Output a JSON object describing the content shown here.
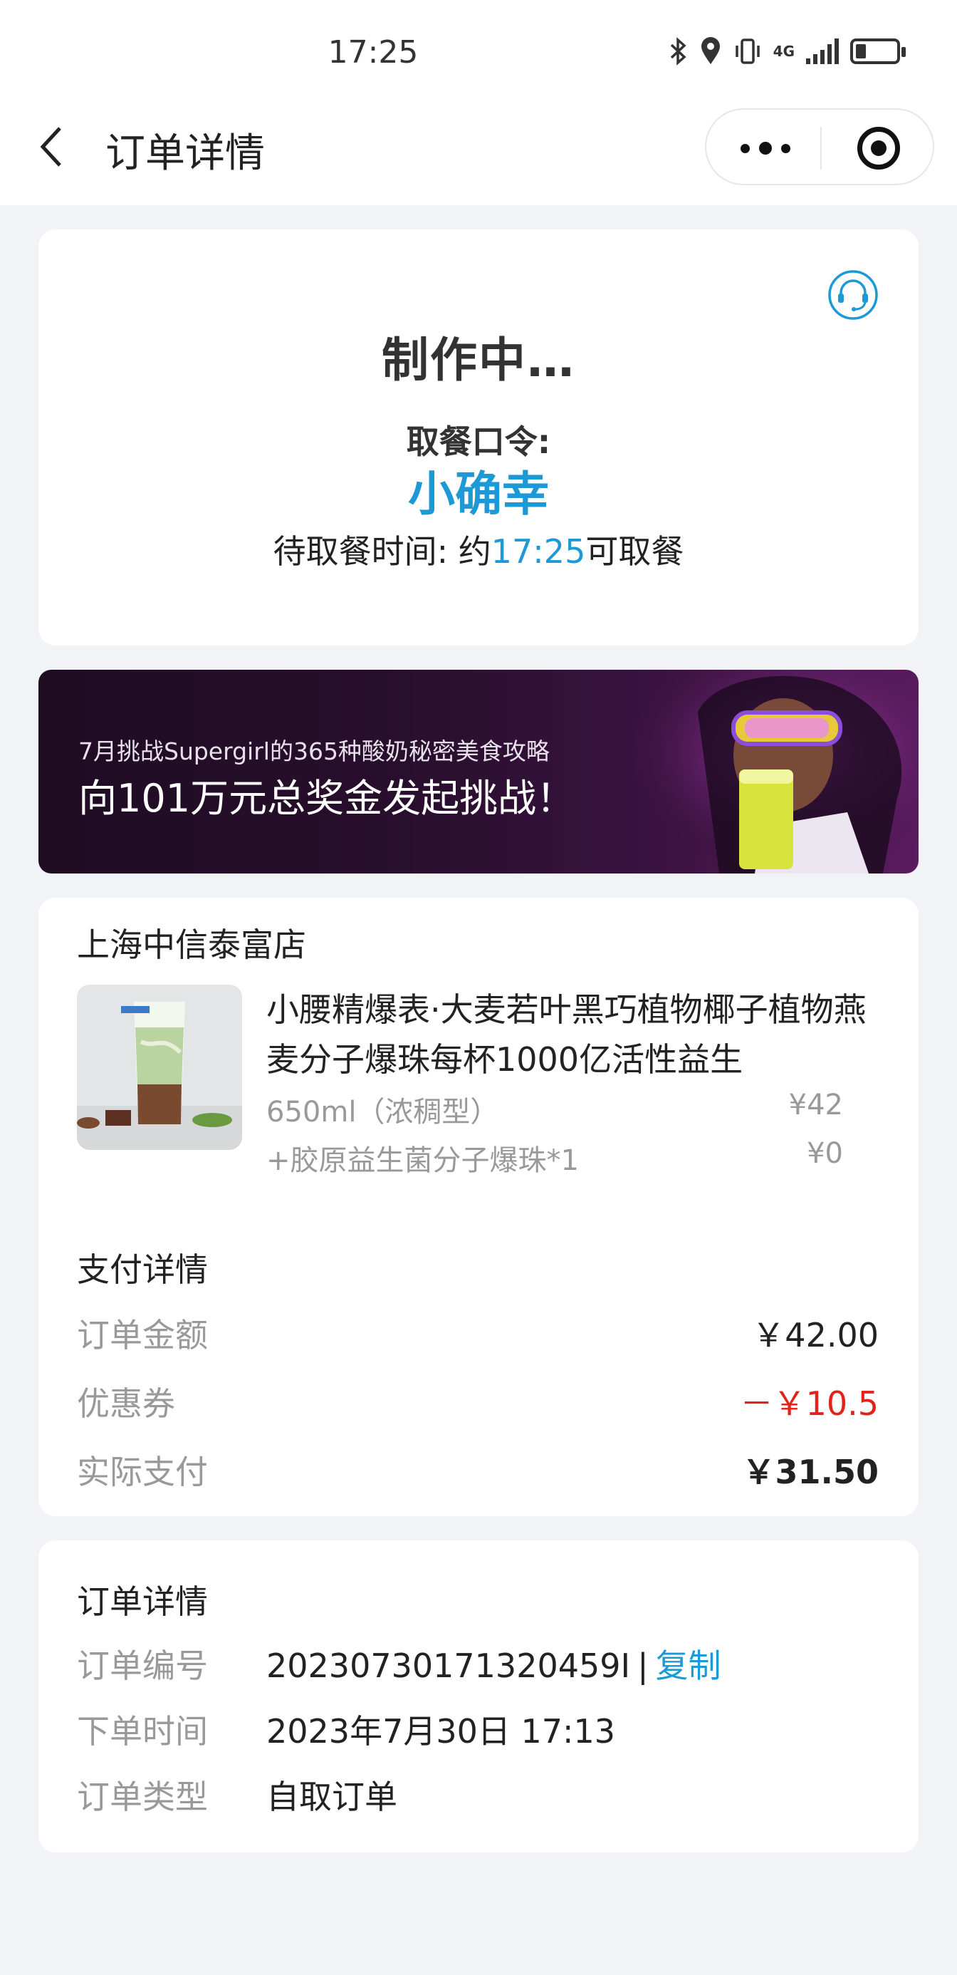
{
  "status_bar": {
    "time": "17:25",
    "network": "4G",
    "icons": [
      "bluetooth-icon",
      "location-icon",
      "vibrate-icon",
      "signal-icon",
      "battery-icon"
    ]
  },
  "nav": {
    "title": "订单详情",
    "icons": [
      "back-icon",
      "more-icon",
      "target-icon"
    ]
  },
  "status": {
    "title": "制作中…",
    "pickup_label": "取餐口令:",
    "pickup_code": "小确幸",
    "wait_prefix": "待取餐时间: 约",
    "wait_time": "17:25",
    "wait_suffix": "可取餐",
    "service_icon": "headset-icon"
  },
  "banner": {
    "subtitle": "7月挑战Supergirl的365种酸奶秘密美食攻略",
    "title": "向101万元总奖金发起挑战！"
  },
  "order": {
    "store": "上海中信泰富店",
    "item": {
      "name": "小腰精爆表·大麦若叶黑巧植物椰子植物燕麦分子爆珠每杯1000亿活性益生",
      "spec": "650ml（浓稠型）",
      "spec_price": "¥42",
      "addon": "+胶原益生菌分子爆珠*1",
      "addon_price": "¥0"
    }
  },
  "payment": {
    "title": "支付详情",
    "rows": [
      {
        "label": "订单金额",
        "value": "￥42.00"
      },
      {
        "label": "优惠券",
        "value": "－￥10.5"
      },
      {
        "label": "实际支付",
        "value": "￥31.50"
      }
    ],
    "colors": {
      "discount": "#e0241b",
      "accent": "#1d9ad6"
    }
  },
  "details": {
    "title": "订单详情",
    "order_no_label": "订单编号",
    "order_no": "20230730171320459I",
    "separator": "|",
    "copy_label": "复制",
    "time_label": "下单时间",
    "time": "2023年7月30日 17:13",
    "type_label": "订单类型",
    "type": "自取订单"
  }
}
